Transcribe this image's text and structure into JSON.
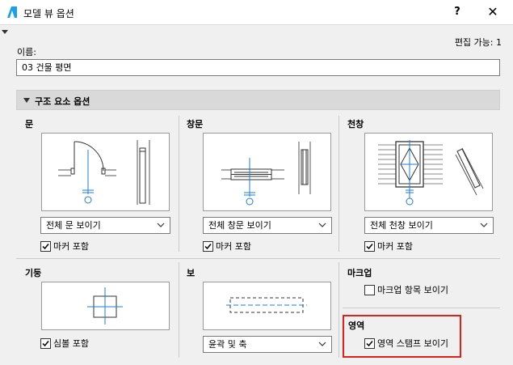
{
  "window": {
    "title": "모델 뷰 옵션",
    "help_label": "?",
    "close_label": "✕"
  },
  "editable_text": "편집 가능: 1",
  "name_field": {
    "label": "이름:",
    "value": "03 건물 평면"
  },
  "section": {
    "title": "구조 요소 옵션"
  },
  "door": {
    "title": "문",
    "dropdown": "전체 문 보이기",
    "checkbox": "마커 포함",
    "checked": true
  },
  "window_opt": {
    "title": "창문",
    "dropdown": "전체 창문 보이기",
    "checkbox": "마커 포함",
    "checked": true
  },
  "skylight": {
    "title": "천창",
    "dropdown": "전체 천창 보이기",
    "checkbox": "마커 포함",
    "checked": true
  },
  "column": {
    "title": "기둥",
    "checkbox": "심볼 포함",
    "checked": true
  },
  "beam": {
    "title": "보",
    "dropdown": "윤곽 및 축"
  },
  "markup": {
    "title": "마크업",
    "checkbox": "마크업 항목 보이기",
    "checked": false
  },
  "zone": {
    "title": "영역",
    "checkbox": "영역 스탬프 보이기",
    "checked": true
  },
  "colors": {
    "accent_blue": "#1a7fd4",
    "highlight_red": "#e0201a"
  }
}
